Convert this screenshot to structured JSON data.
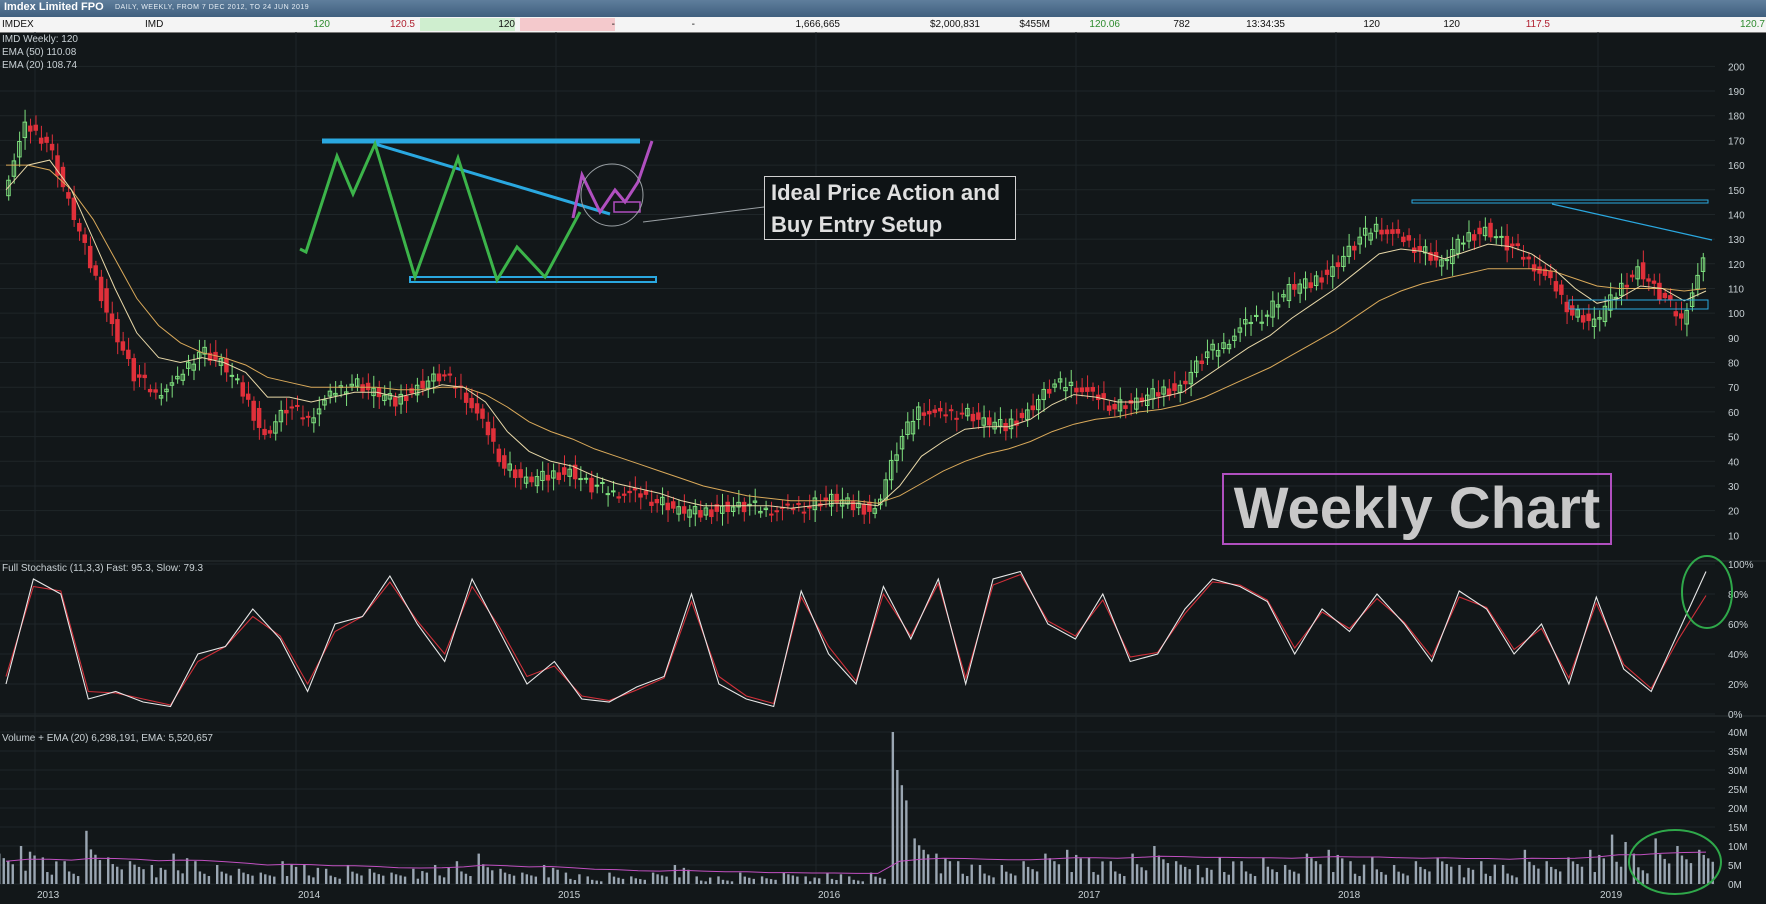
{
  "header": {
    "title": "Imdex Limited FPO",
    "subtitle": "DAILY, WEEKLY, FROM 7 DEC 2012, TO 24 JUN 2019"
  },
  "quote_bar": [
    {
      "text": "IMDEX",
      "color": "#111111",
      "bg": "",
      "align": "left"
    },
    {
      "text": "IMD",
      "color": "#111111",
      "bg": "",
      "align": "left"
    },
    {
      "text": "120",
      "color": "#2e8b2e",
      "bg": "",
      "align": "right"
    },
    {
      "text": "120.5",
      "color": "#b02030",
      "bg": "",
      "align": "right"
    },
    {
      "text": "120",
      "color": "#111111",
      "bg": "#cfeecf",
      "align": "right"
    },
    {
      "text": "-",
      "color": "#111111",
      "bg": "#f4c9cc",
      "align": "right"
    },
    {
      "text": "-",
      "color": "#111111",
      "bg": "",
      "align": "right"
    },
    {
      "text": "1,666,665",
      "color": "#111111",
      "bg": "",
      "align": "right"
    },
    {
      "text": "$2,000,831",
      "color": "#111111",
      "bg": "",
      "align": "right"
    },
    {
      "text": "$455M",
      "color": "#111111",
      "bg": "",
      "align": "right"
    },
    {
      "text": "120.06",
      "color": "#2e8b2e",
      "bg": "",
      "align": "right"
    },
    {
      "text": "782",
      "color": "#111111",
      "bg": "",
      "align": "right"
    },
    {
      "text": "13:34:35",
      "color": "#111111",
      "bg": "",
      "align": "right"
    },
    {
      "text": "120",
      "color": "#111111",
      "bg": "",
      "align": "right"
    },
    {
      "text": "120",
      "color": "#111111",
      "bg": "",
      "align": "right"
    },
    {
      "text": "117.5",
      "color": "#b02030",
      "bg": "",
      "align": "right"
    },
    {
      "text": "120.7",
      "color": "#2e8b2e",
      "bg": "",
      "align": "right"
    }
  ],
  "price_labels": {
    "series": "IMD Weekly: 120",
    "ema50": "EMA (50) 110.08",
    "ema20": "EMA (20) 108.74"
  },
  "stoch_label": "Full Stochastic (11,3,3) Fast: 95.3, Slow: 79.3",
  "volume_label": "Volume + EMA (20) 6,298,191, EMA: 5,520,657",
  "annotations": {
    "ideal_line1": "Ideal Price Action and",
    "ideal_line2": "Buy Entry Setup",
    "weekly": "Weekly Chart"
  },
  "colors": {
    "up": "#7ee07e",
    "down": "#e0303a",
    "ema50": "#d9a95a",
    "ema20": "#e8d8a8",
    "stoch_fast": "#e8e8e8",
    "stoch_slow": "#d0303a",
    "volume": "#9aa6b2",
    "volume_ema": "#c050c0",
    "trendline": "#2aa8e0",
    "pattern": "#3cb44a",
    "pattern_breakout": "#b04fbf",
    "highlight_circle": "#2fa84a"
  },
  "chart_data": [
    {
      "type": "line",
      "panel": "price",
      "x_ticks": [
        "2013",
        "2014",
        "2015",
        "2016",
        "2017",
        "2018",
        "2019"
      ],
      "y_ticks": [
        10,
        20,
        30,
        40,
        50,
        60,
        70,
        80,
        90,
        100,
        110,
        120,
        130,
        140,
        150,
        160,
        170,
        180,
        190,
        200
      ],
      "ylim": [
        0,
        205
      ],
      "x_range": [
        "2012-12-07",
        "2019-06-24"
      ],
      "series": [
        {
          "name": "IMD Weekly",
          "x": [
            "2012-12",
            "2013-01",
            "2013-02",
            "2013-03",
            "2013-04",
            "2013-05",
            "2013-06",
            "2013-07",
            "2013-08",
            "2013-09",
            "2013-10",
            "2013-11",
            "2013-12",
            "2014-01",
            "2014-02",
            "2014-03",
            "2014-04",
            "2014-05",
            "2014-06",
            "2014-07",
            "2014-08",
            "2014-09",
            "2014-10",
            "2014-11",
            "2014-12",
            "2015-01",
            "2015-02",
            "2015-03",
            "2015-04",
            "2015-05",
            "2015-06",
            "2015-07",
            "2015-08",
            "2015-09",
            "2015-10",
            "2015-11",
            "2015-12",
            "2016-01",
            "2016-02",
            "2016-03",
            "2016-04",
            "2016-05",
            "2016-06",
            "2016-07",
            "2016-08",
            "2016-09",
            "2016-10",
            "2016-11",
            "2016-12",
            "2017-01",
            "2017-02",
            "2017-03",
            "2017-04",
            "2017-05",
            "2017-06",
            "2017-07",
            "2017-08",
            "2017-09",
            "2017-10",
            "2017-11",
            "2017-12",
            "2018-01",
            "2018-02",
            "2018-03",
            "2018-04",
            "2018-05",
            "2018-06",
            "2018-07",
            "2018-08",
            "2018-09",
            "2018-10",
            "2018-11",
            "2018-12",
            "2019-01",
            "2019-02",
            "2019-03",
            "2019-04",
            "2019-05",
            "2019-06"
          ],
          "values": [
            150,
            175,
            170,
            145,
            120,
            95,
            75,
            68,
            72,
            85,
            80,
            68,
            50,
            62,
            58,
            66,
            72,
            68,
            64,
            70,
            75,
            70,
            55,
            38,
            32,
            34,
            36,
            30,
            28,
            26,
            24,
            20,
            19,
            21,
            22,
            21,
            20,
            22,
            25,
            22,
            20,
            45,
            62,
            58,
            60,
            56,
            54,
            60,
            70,
            72,
            66,
            62,
            64,
            68,
            70,
            82,
            88,
            95,
            100,
            110,
            112,
            118,
            128,
            136,
            130,
            126,
            120,
            130,
            134,
            128,
            122,
            112,
            100,
            96,
            108,
            118,
            108,
            98,
            120
          ]
        },
        {
          "name": "EMA (50)",
          "values": [
            160,
            160,
            158,
            150,
            138,
            122,
            106,
            95,
            88,
            84,
            82,
            79,
            74,
            72,
            70,
            70,
            70,
            70,
            69,
            69,
            70,
            70,
            67,
            62,
            56,
            52,
            49,
            45,
            42,
            39,
            36,
            33,
            30,
            28,
            26,
            25,
            24,
            24,
            24,
            24,
            23,
            26,
            31,
            36,
            40,
            43,
            45,
            48,
            52,
            55,
            57,
            58,
            60,
            61,
            63,
            66,
            70,
            74,
            78,
            83,
            88,
            93,
            99,
            105,
            109,
            112,
            114,
            116,
            118,
            118,
            118,
            117,
            114,
            111,
            110,
            110,
            110,
            109,
            110
          ]
        },
        {
          "name": "EMA (20)",
          "values": [
            150,
            160,
            162,
            150,
            130,
            110,
            92,
            82,
            80,
            82,
            80,
            76,
            66,
            66,
            64,
            66,
            68,
            68,
            66,
            68,
            71,
            70,
            64,
            52,
            44,
            40,
            38,
            34,
            31,
            29,
            27,
            24,
            22,
            22,
            22,
            22,
            21,
            22,
            23,
            23,
            22,
            30,
            42,
            48,
            53,
            54,
            54,
            57,
            63,
            67,
            66,
            64,
            64,
            66,
            68,
            74,
            80,
            86,
            91,
            98,
            104,
            110,
            117,
            124,
            126,
            125,
            122,
            125,
            128,
            127,
            124,
            118,
            110,
            104,
            106,
            111,
            110,
            105,
            109
          ]
        }
      ],
      "annotations": [
        "Ideal Price Action and Buy Entry Setup",
        "Weekly Chart"
      ]
    },
    {
      "type": "line",
      "panel": "stochastic",
      "y_ticks": [
        "0%",
        "20%",
        "40%",
        "60%",
        "80%",
        "100%"
      ],
      "ylim": [
        0,
        100
      ],
      "series": [
        {
          "name": "Fast",
          "values": [
            20,
            90,
            80,
            10,
            15,
            8,
            5,
            40,
            45,
            70,
            50,
            15,
            60,
            65,
            92,
            60,
            35,
            90,
            55,
            20,
            35,
            10,
            8,
            18,
            25,
            80,
            20,
            10,
            5,
            82,
            40,
            20,
            85,
            50,
            90,
            20,
            90,
            95,
            60,
            50,
            80,
            35,
            40,
            70,
            90,
            85,
            75,
            40,
            70,
            55,
            80,
            60,
            35,
            82,
            70,
            40,
            60,
            20,
            78,
            30,
            15,
            55,
            95
          ]
        },
        {
          "name": "Slow",
          "values": [
            25,
            85,
            82,
            15,
            14,
            10,
            6,
            35,
            45,
            65,
            52,
            20,
            55,
            65,
            88,
            62,
            40,
            85,
            58,
            25,
            32,
            12,
            9,
            16,
            24,
            75,
            25,
            12,
            7,
            78,
            45,
            22,
            80,
            52,
            87,
            24,
            86,
            93,
            62,
            52,
            76,
            38,
            41,
            67,
            88,
            86,
            76,
            44,
            68,
            57,
            77,
            61,
            38,
            78,
            71,
            43,
            57,
            24,
            74,
            33,
            17,
            50,
            79
          ]
        }
      ]
    },
    {
      "type": "bar",
      "panel": "volume",
      "y_ticks": [
        "0M",
        "5M",
        "10M",
        "15M",
        "20M",
        "25M",
        "30M",
        "35M",
        "40M"
      ],
      "ylim": [
        0,
        40
      ],
      "series": [
        {
          "name": "Volume",
          "values": [
            8,
            10,
            7,
            6,
            14,
            7,
            6,
            5,
            8,
            6,
            5,
            4,
            3,
            6,
            5,
            4,
            5,
            4,
            3,
            4,
            5,
            6,
            8,
            4,
            3,
            5,
            3,
            2,
            3,
            2,
            3,
            5,
            2,
            2,
            3,
            2,
            3,
            2,
            3,
            2,
            3,
            40,
            12,
            8,
            6,
            5,
            5,
            6,
            8,
            9,
            7,
            6,
            8,
            10,
            6,
            5,
            7,
            6,
            7,
            5,
            8,
            9,
            6,
            7,
            5,
            6,
            7,
            5,
            6,
            5,
            9,
            6,
            7,
            9,
            13,
            8,
            12,
            10,
            9
          ]
        },
        {
          "name": "EMA",
          "values": [
            6,
            6.5,
            6.5,
            6.3,
            6.8,
            6.7,
            6.5,
            6.1,
            6.3,
            6.2,
            5.9,
            5.5,
            5,
            5.2,
            5.1,
            4.8,
            4.8,
            4.6,
            4.3,
            4.2,
            4.3,
            4.5,
            5,
            4.8,
            4.5,
            4.6,
            4.3,
            3.9,
            3.8,
            3.5,
            3.4,
            3.6,
            3.4,
            3.2,
            3.2,
            3,
            3,
            2.9,
            2.9,
            2.8,
            2.8,
            6,
            6.5,
            6.8,
            6.7,
            6.5,
            6.4,
            6.4,
            6.6,
            6.9,
            6.9,
            6.8,
            7,
            7.3,
            7.2,
            7,
            7,
            6.9,
            6.9,
            6.8,
            7,
            7.2,
            7.1,
            7.1,
            6.9,
            6.8,
            6.9,
            6.7,
            6.7,
            6.5,
            6.8,
            6.7,
            6.8,
            7.1,
            7.7,
            7.7,
            8.1,
            8.3,
            8.4
          ]
        }
      ]
    }
  ]
}
